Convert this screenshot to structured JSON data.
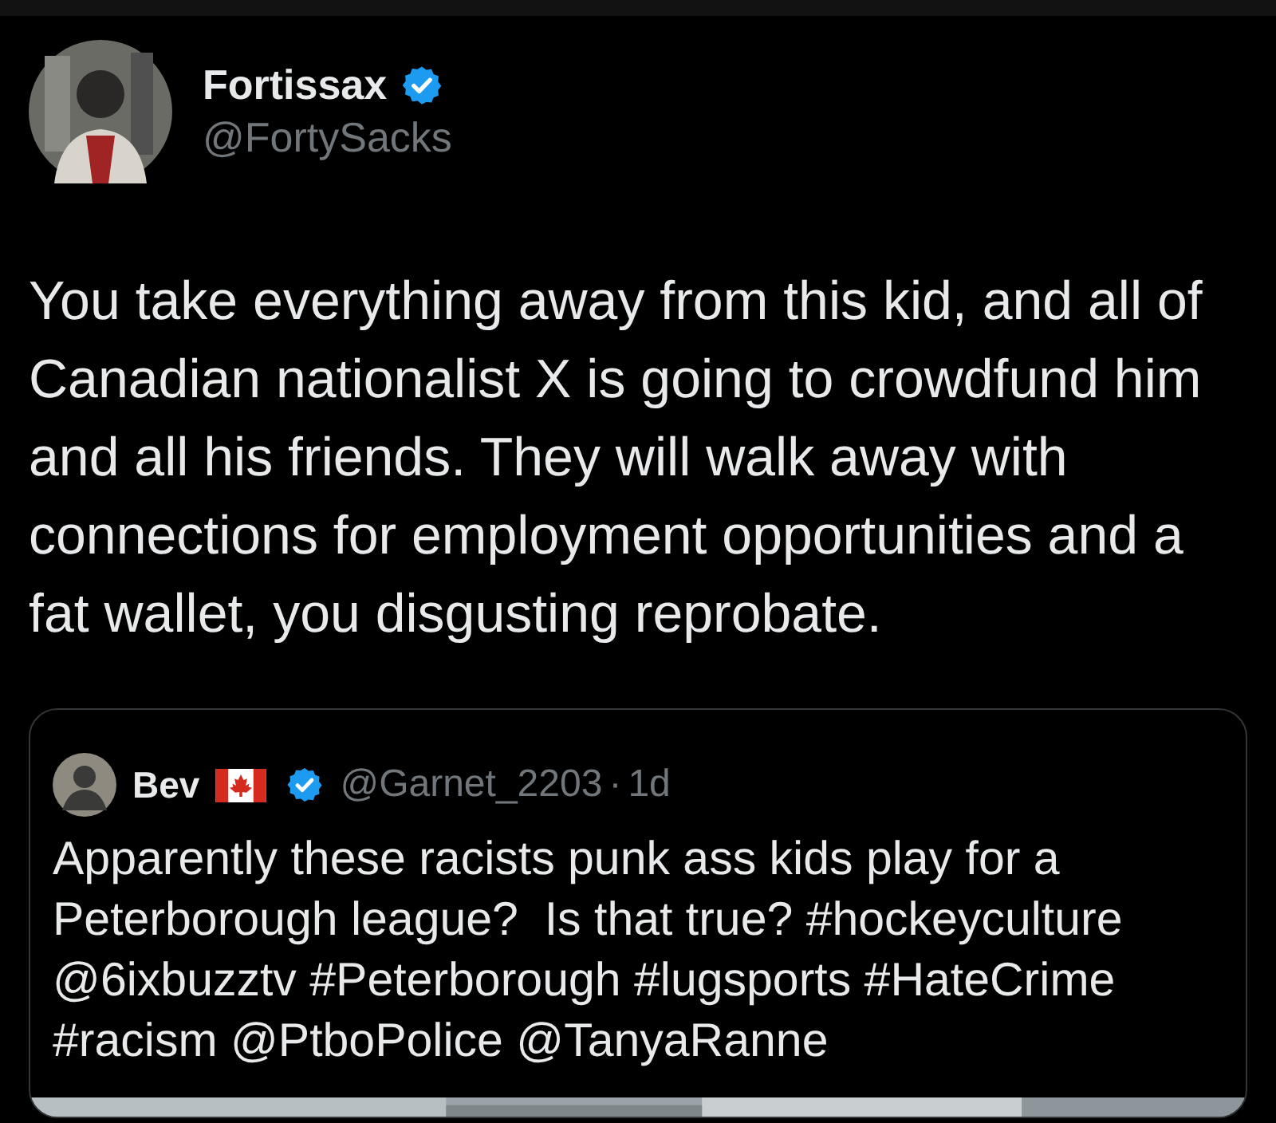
{
  "post": {
    "author": {
      "name": "Fortissax",
      "handle": "@FortySacks",
      "verified": true
    },
    "text": "You take everything away from this kid, and all of Canadian nationalist X is going to crowdfund him and all his friends. They will walk away with connections for employment opportunities and a fat wallet, you disgusting reprobate.",
    "quoted_post": {
      "author": {
        "name": "Bev",
        "handle": "@Garnet_2203",
        "verified": true
      },
      "separator": "·",
      "time": "1d",
      "text": "Apparently these racists punk ass kids play for a Peterborough league?  Is that true? #hockeyculture @6ixbuzztv #Peterborough #lugsports #HateCrime #racism @PtboPolice @TanyaRanne"
    }
  }
}
